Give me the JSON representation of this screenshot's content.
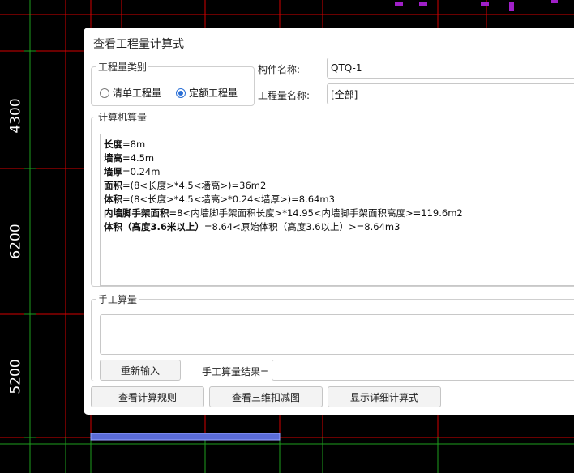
{
  "cad": {
    "dim_4300": "4300",
    "dim_6200": "6200",
    "dim_5200": "5200"
  },
  "dialog": {
    "title": "查看工程量计算式",
    "category": {
      "legend": "工程量类别",
      "options": [
        {
          "label": "清单工程量",
          "selected": false
        },
        {
          "label": "定额工程量",
          "selected": true
        }
      ]
    },
    "component_name_label": "构件名称:",
    "component_name_value": "QTQ-1",
    "quantity_name_label": "工程量名称:",
    "quantity_name_value": "[全部]",
    "computer_calc": {
      "legend": "计算机算量",
      "lines": [
        {
          "key": "长度",
          "rest": "=8m"
        },
        {
          "key": "墙高",
          "rest": "=4.5m"
        },
        {
          "key": "墙厚",
          "rest": "=0.24m"
        },
        {
          "key": "面积",
          "rest": "=(8<长度>*4.5<墙高>)=36m2"
        },
        {
          "key": "体积",
          "rest": "=(8<长度>*4.5<墙高>*0.24<墙厚>)=8.64m3"
        },
        {
          "key": "内墙脚手架面积",
          "rest": "=8<内墙脚手架面积长度>*14.95<内墙脚手架面积高度>=119.6m2"
        },
        {
          "key": "体积（高度3.6米以上）",
          "rest": "=8.64<原始体积（高度3.6以上）>=8.64m3"
        }
      ]
    },
    "manual_calc": {
      "legend": "手工算量",
      "reenter_button": "重新输入",
      "result_label": "手工算量结果="
    },
    "buttons": {
      "view_rules": "查看计算规则",
      "view_3d": "查看三维扣减图",
      "show_detail": "显示详细计算式"
    },
    "colors": {
      "accent": "#2a6fd6",
      "cad_red": "#d40000",
      "cad_green": "#1e9e1e",
      "cad_purple": "#a020c8",
      "cad_blue_bar": "#5b6cd8"
    }
  }
}
